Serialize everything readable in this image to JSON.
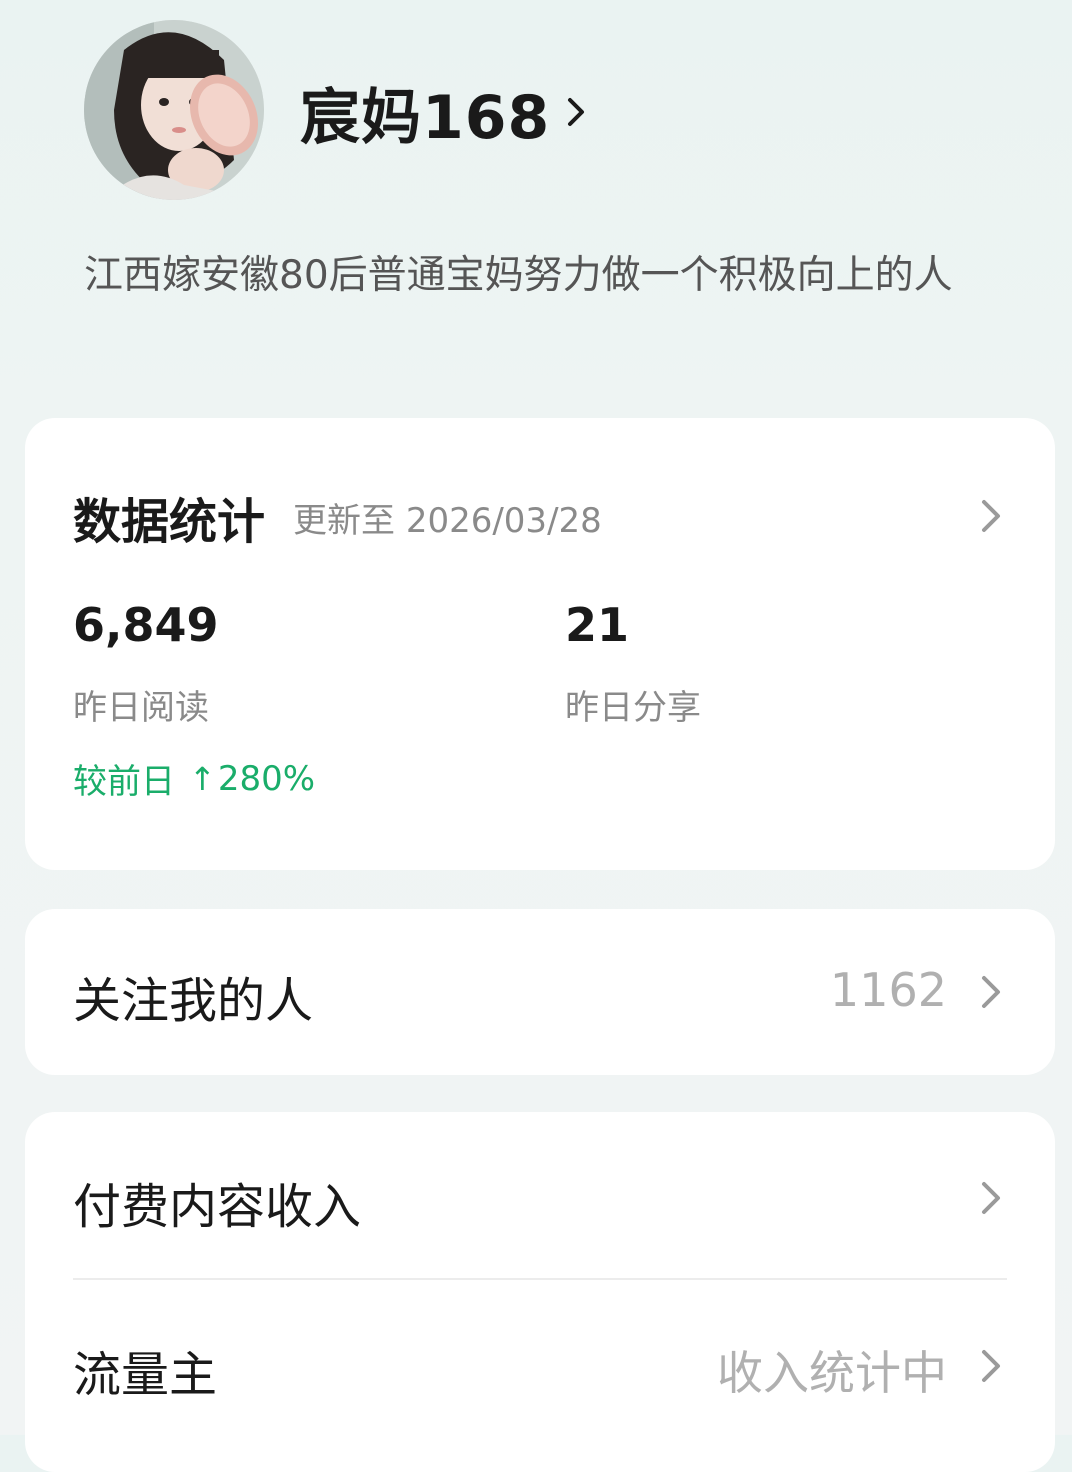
{
  "profile": {
    "name": "宸妈168",
    "bio": "江西嫁安徽80后普通宝妈努力做一个积极向上的人"
  },
  "stats": {
    "title": "数据统计",
    "updated": "更新至 2026/03/28",
    "reads_value": "6,849",
    "reads_label": "昨日阅读",
    "compare_label": "较前日",
    "compare_arrow": "↑",
    "compare_value": "280%",
    "shares_value": "21",
    "shares_label": "昨日分享"
  },
  "followers": {
    "label": "关注我的人",
    "count": "1162"
  },
  "income": {
    "paid_content_label": "付费内容收入",
    "traffic_label": "流量主",
    "traffic_status": "收入统计中"
  },
  "colors": {
    "accent_green": "#1aad6a",
    "muted_text": "#8a8a8a",
    "background": "#eef4f3"
  },
  "icons": {
    "chevron": "chevron-right-icon"
  }
}
